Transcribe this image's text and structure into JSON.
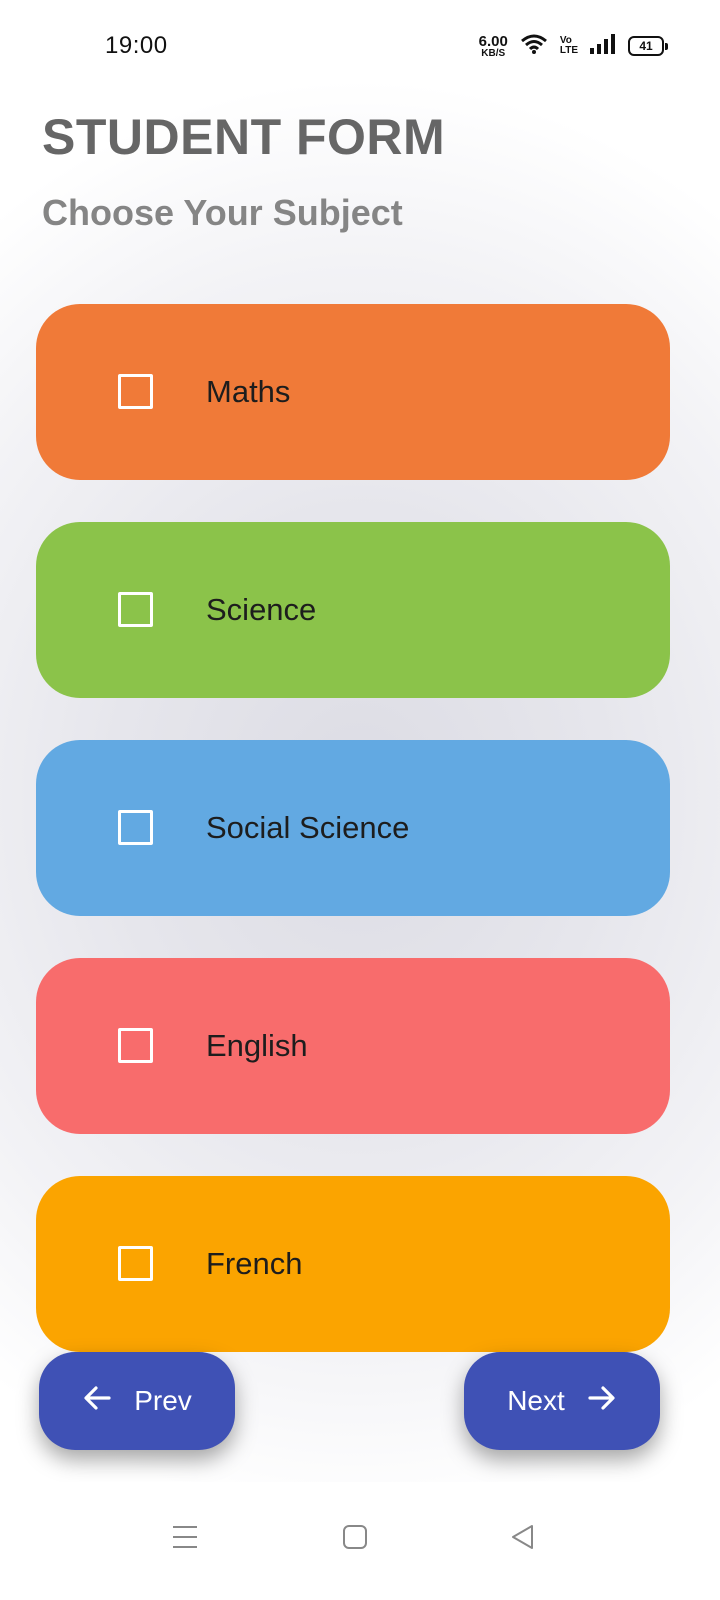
{
  "status_bar": {
    "time": "19:00",
    "net_speed_value": "6.00",
    "net_speed_unit": "KB/S",
    "volte_top": "Vo",
    "volte_bottom": "LTE",
    "battery": "41",
    "icons": [
      "wifi-icon",
      "signal-icon",
      "battery-icon"
    ]
  },
  "header": {
    "title": "STUDENT FORM",
    "subtitle": "Choose Your Subject"
  },
  "subjects": [
    {
      "label": "Maths",
      "color": "#f07a38",
      "checked": false
    },
    {
      "label": "Science",
      "color": "#8bc34a",
      "checked": false
    },
    {
      "label": "Social Science",
      "color": "#62a9e2",
      "checked": false
    },
    {
      "label": "English",
      "color": "#f86c6c",
      "checked": false
    },
    {
      "label": "French",
      "color": "#fba400",
      "checked": false
    }
  ],
  "nav": {
    "prev_label": "Prev",
    "next_label": "Next",
    "button_color": "#3f51b5"
  },
  "system_nav": {
    "icons": [
      "menu-icon",
      "home-icon",
      "back-icon"
    ]
  }
}
